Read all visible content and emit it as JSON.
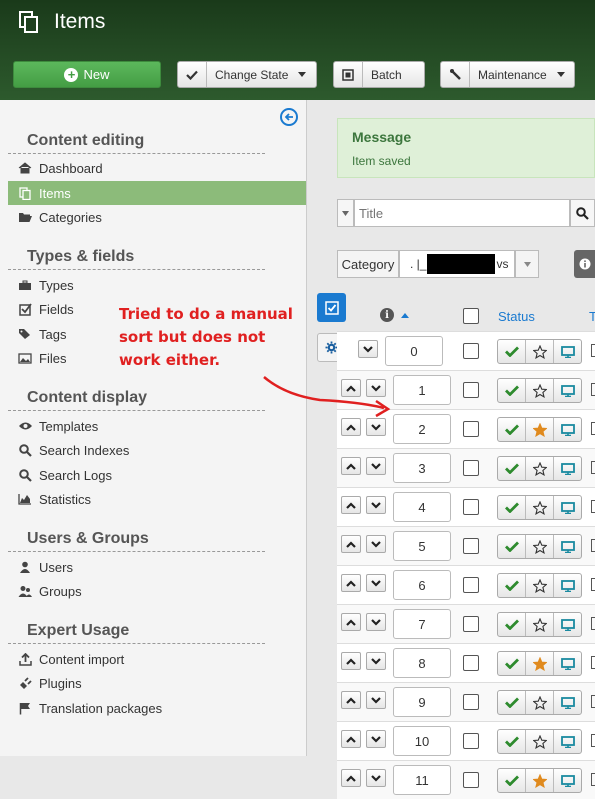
{
  "header": {
    "title": "Items",
    "new_label": "New",
    "change_state_label": "Change State",
    "batch_label": "Batch",
    "maintenance_label": "Maintenance"
  },
  "sidebar": {
    "sections": [
      {
        "title": "Content editing",
        "items": [
          "Dashboard",
          "Items",
          "Categories"
        ]
      },
      {
        "title": "Types & fields",
        "items": [
          "Types",
          "Fields",
          "Tags",
          "Files"
        ]
      },
      {
        "title": "Content display",
        "items": [
          "Templates",
          "Search Indexes",
          "Search Logs",
          "Statistics"
        ]
      },
      {
        "title": "Users & Groups",
        "items": [
          "Users",
          "Groups"
        ]
      },
      {
        "title": "Expert Usage",
        "items": [
          "Content import",
          "Plugins",
          "Translation packages"
        ]
      }
    ],
    "active_item": "Items"
  },
  "message": {
    "title": "Message",
    "text": "Item saved"
  },
  "filters": {
    "search_placeholder": "Title",
    "category_label": "Category",
    "category_prefix": ". |_",
    "category_suffix": "vs"
  },
  "table": {
    "status_header": "Status",
    "next_header_fragment": "T",
    "rows": [
      {
        "order": "0",
        "featured": false
      },
      {
        "order": "1",
        "featured": false
      },
      {
        "order": "2",
        "featured": true
      },
      {
        "order": "3",
        "featured": false
      },
      {
        "order": "4",
        "featured": false
      },
      {
        "order": "5",
        "featured": false
      },
      {
        "order": "6",
        "featured": false
      },
      {
        "order": "7",
        "featured": false
      },
      {
        "order": "8",
        "featured": true
      },
      {
        "order": "9",
        "featured": false
      },
      {
        "order": "10",
        "featured": false
      },
      {
        "order": "11",
        "featured": true
      }
    ]
  },
  "annotation": {
    "text": "Tried to do a manual sort but does not work either."
  },
  "colors": {
    "header_bg": "#1a3a1a",
    "new_button": "#5cb85c",
    "active_nav": "#8cbb7a",
    "accent_blue": "#1a7ad0",
    "message_bg": "#dff0d8",
    "annotation_red": "#e02020",
    "featured_star": "#e08a1e",
    "published_check": "#2e8b2e"
  }
}
